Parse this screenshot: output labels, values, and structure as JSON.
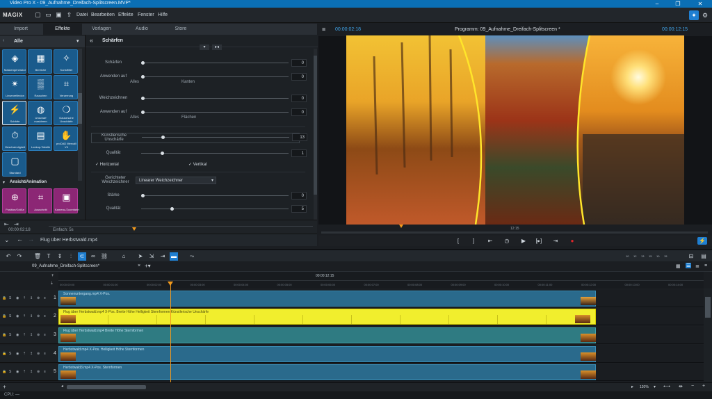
{
  "window": {
    "title": "Video Pro X - 09_Aufnahme_Dreifach-Splitscreen.MVP*"
  },
  "menu": {
    "logo": "MAGIX",
    "items": [
      "Datei",
      "Bearbeiten",
      "Effekte",
      "Fenster",
      "Hilfe"
    ]
  },
  "media_tabs": [
    "Import",
    "Effekte",
    "Vorlagen",
    "Audio",
    "Store"
  ],
  "effect_browser": {
    "category_all": "Alle",
    "effects": [
      {
        "label": "Maskengenerator",
        "icon": "mask-icon"
      },
      {
        "label": "Bereiche",
        "icon": "range-icon"
      },
      {
        "label": "Kunstfilter",
        "icon": "art-filter-icon"
      },
      {
        "label": "Linsenreflexion",
        "icon": "lens-flare-icon"
      },
      {
        "label": "Rauschen",
        "icon": "noise-icon"
      },
      {
        "label": "Verzerrung",
        "icon": "distortion-icon"
      },
      {
        "label": "Schärfe",
        "icon": "sharpness-icon"
      },
      {
        "label": "Unscharf maskieren",
        "icon": "unsharp-mask-icon"
      },
      {
        "label": "Gauss'sche Unschärfe",
        "icon": "gauss-blur-icon"
      },
      {
        "label": "Geschwindigkeit",
        "icon": "speed-icon"
      },
      {
        "label": "Lookup-Tabelle",
        "icon": "lut-icon"
      },
      {
        "label": "proDAD Mercalli V4",
        "icon": "mercalli-icon"
      },
      {
        "label": "Standard",
        "icon": "standard-icon"
      }
    ],
    "category_anim": "Ansicht/Animation",
    "anim_effects": [
      {
        "label": "Position/Größe",
        "icon": "position-icon"
      },
      {
        "label": "Ausschnitt",
        "icon": "crop-icon"
      },
      {
        "label": "Kamera-/Zoomfahrt",
        "icon": "camera-zoom-icon"
      }
    ]
  },
  "settings": {
    "title": "Schärfen",
    "rows": [
      {
        "label": "Schärfen",
        "value": "0",
        "knob": 0.0
      },
      {
        "label": "Anwenden auf",
        "value": "0",
        "knob": 0.0,
        "left": "Alles",
        "right": "Kanten"
      },
      {
        "label": "Weichzeichnen",
        "value": "0",
        "knob": 0.0
      },
      {
        "label": "Anwenden auf",
        "value": "0",
        "knob": 0.0,
        "left": "Alles",
        "right": "Flächen"
      },
      {
        "label": "Künstlerische Unschärfe",
        "value": "13",
        "knob": 0.13
      },
      {
        "label": "Qualität",
        "value": "1",
        "knob": 0.13
      }
    ],
    "check_horizontal": "Horizontal",
    "check_vertical": "Vertikal",
    "directional_label": "Gerichteter Weichzeichner",
    "directional_value": "Linearer Weichzeichner",
    "strength": {
      "label": "Stärke",
      "value": "0",
      "knob": 0.0
    },
    "quality2": {
      "label": "Qualität",
      "value": "5",
      "knob": 0.2
    }
  },
  "left_bottom": {
    "timecode": "00:00:02:18",
    "entry_label": "Einfach: 5s"
  },
  "nav": {
    "path": "Flug über Herbstwald.mp4"
  },
  "monitor": {
    "tc_left": "00:00:02:18",
    "title": "Programm: 09_Aufnahme_Dreifach-Splitscreen *",
    "tc_right": "00:00:12:15",
    "scrub_label": "12:15"
  },
  "timeline": {
    "tab": "09_Aufnahme_Dreifach-Splitscreen*",
    "ruler_center": "00:00:12:15",
    "ruler_ticks": [
      "00:00:00:00",
      "00:00:01:00",
      "00:00:02:00",
      "00:00:03:00",
      "00:00:04:00",
      "00:00:05:00",
      "00:00:06:00",
      "00:00:07:00",
      "00:00:08:00",
      "00:00:09:00",
      "00:00:10:00",
      "00:00:11:00",
      "00:00:12:00",
      "00:00:13:00",
      "00:00:14:00"
    ],
    "zoom_values": [
      "10",
      "12",
      "13",
      "15",
      "10",
      "15"
    ],
    "tracks": [
      {
        "num": "1",
        "clip": "Sonnenuntergang.mp4  X-Pos.",
        "color": "blue"
      },
      {
        "num": "2",
        "clip": "Flug über Herbstwald.mp4  X-Pos.  Breite  Höhe  Helligkeit  Sternformen  Künstlerische Unschärfe",
        "color": "yellow"
      },
      {
        "num": "3",
        "clip": "Flug über Herbstwald.mp4  Breite  Höhe  Sternformen",
        "color": "teal"
      },
      {
        "num": "4",
        "clip": "Herbstwald.mp4  X-Pos.  Helligkeit  Höhe  Sternformen",
        "color": "blue"
      },
      {
        "num": "5",
        "clip": "Herbstwald3.mp4  X-Pos.  Sternformen",
        "color": "blue"
      }
    ]
  },
  "bottom": {
    "zoom": "120%",
    "status": "CPU: —"
  },
  "colors": {
    "accent": "#0b6fb5",
    "timecode": "#3fa3e8",
    "clip_blue": "#2a6a8c",
    "clip_yellow": "#f1ee2d",
    "playhead": "#f29a1d",
    "record": "#e0262b"
  }
}
